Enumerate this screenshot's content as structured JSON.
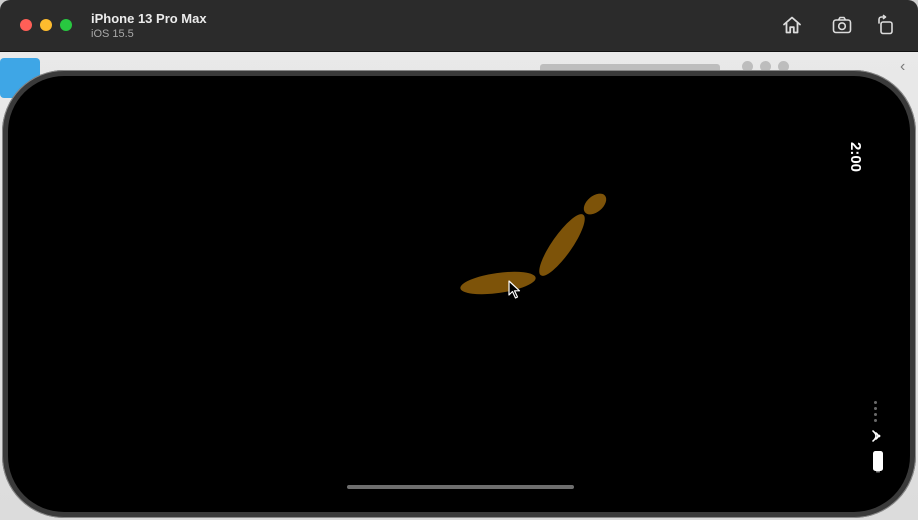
{
  "window": {
    "device_name": "iPhone 13 Pro Max",
    "os_version": "iOS 15.5"
  },
  "toolbar": {
    "home_icon": "home-icon",
    "screenshot_icon": "screenshot-icon",
    "rotate_icon": "rotate-icon"
  },
  "status_bar": {
    "time": "2:00",
    "wifi_icon": "wifi-icon",
    "battery_icon": "battery-icon"
  },
  "colors": {
    "shape_fill": "#7d5309",
    "screen_bg": "#000000",
    "titlebar_bg": "#2b2b2b"
  }
}
